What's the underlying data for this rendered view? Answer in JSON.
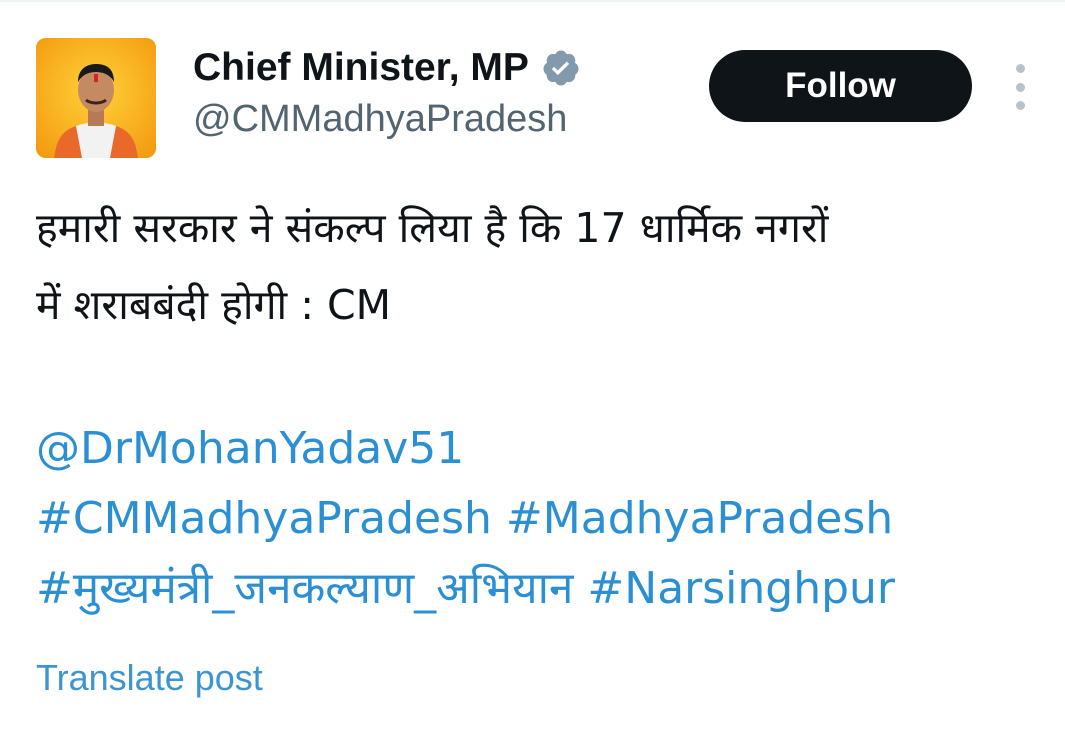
{
  "post": {
    "author": {
      "display_name": "Chief Minister, MP",
      "handle": "@CMMadhyaPradesh",
      "verified": true,
      "avatar_icon": "profile-photo"
    },
    "follow_label": "Follow",
    "more_icon": "more-vertical-icon",
    "text_lines": [
      "हमारी सरकार ने संकल्प लिया है कि 17 धार्मिक नगरों",
      "में शराबबंदी होगी : CM"
    ],
    "mention": "@DrMohanYadav51",
    "hashtags": [
      "#CMMadhyaPradesh",
      "#MadhyaPradesh",
      "#मुख्यमंत्री_जनकल्याण_अभियान",
      "#Narsinghpur"
    ],
    "translate_label": "Translate post"
  },
  "colors": {
    "link": "#1d9bf0",
    "text": "#0f1419",
    "secondary": "#536471",
    "button_bg": "#0f1419",
    "avatar_bg": "#f6a316"
  }
}
